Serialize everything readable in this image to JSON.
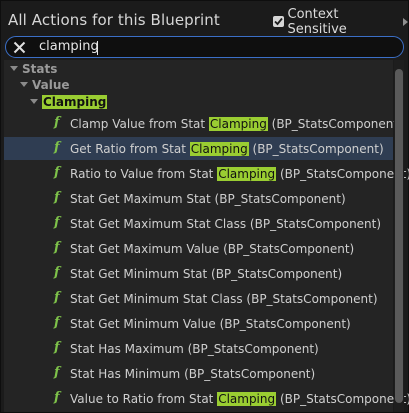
{
  "header": {
    "title": "All Actions for this Blueprint",
    "context_sensitive_label": "Context Sensitive",
    "context_sensitive_checked": true
  },
  "search": {
    "value": "clamping"
  },
  "tree": {
    "categories": [
      {
        "label": "Stats"
      },
      {
        "label": "Value"
      },
      {
        "label": "Clamping"
      }
    ],
    "actions": [
      {
        "before": "Clamp Value from Stat ",
        "match": "Clamping",
        "after": " (BP_StatsComponent)",
        "selected": false
      },
      {
        "before": "Get Ratio from Stat ",
        "match": "Clamping",
        "after": " (BP_StatsComponent)",
        "selected": true
      },
      {
        "before": "Ratio to Value from Stat ",
        "match": "Clamping",
        "after": " (BP_StatsComponent)",
        "selected": false
      },
      {
        "before": "Stat Get Maximum Stat (BP_StatsComponent)",
        "match": "",
        "after": "",
        "selected": false
      },
      {
        "before": "Stat Get Maximum Stat Class (BP_StatsComponent)",
        "match": "",
        "after": "",
        "selected": false
      },
      {
        "before": "Stat Get Maximum Value (BP_StatsComponent)",
        "match": "",
        "after": "",
        "selected": false
      },
      {
        "before": "Stat Get Minimum Stat (BP_StatsComponent)",
        "match": "",
        "after": "",
        "selected": false
      },
      {
        "before": "Stat Get Minimum Stat Class (BP_StatsComponent)",
        "match": "",
        "after": "",
        "selected": false
      },
      {
        "before": "Stat Get Minimum Value (BP_StatsComponent)",
        "match": "",
        "after": "",
        "selected": false
      },
      {
        "before": "Stat Has Maximum (BP_StatsComponent)",
        "match": "",
        "after": "",
        "selected": false
      },
      {
        "before": "Stat Has Minimum (BP_StatsComponent)",
        "match": "",
        "after": "",
        "selected": false
      },
      {
        "before": "Value to Ratio from Stat ",
        "match": "Clamping",
        "after": " (BP_StatsComponent)",
        "selected": false
      }
    ],
    "function_icon_glyph": "f"
  },
  "colors": {
    "highlight": "#9acd32",
    "function_icon": "#7ec24a",
    "selected_row": "#2f3d52",
    "search_border": "#3b6fc7"
  }
}
